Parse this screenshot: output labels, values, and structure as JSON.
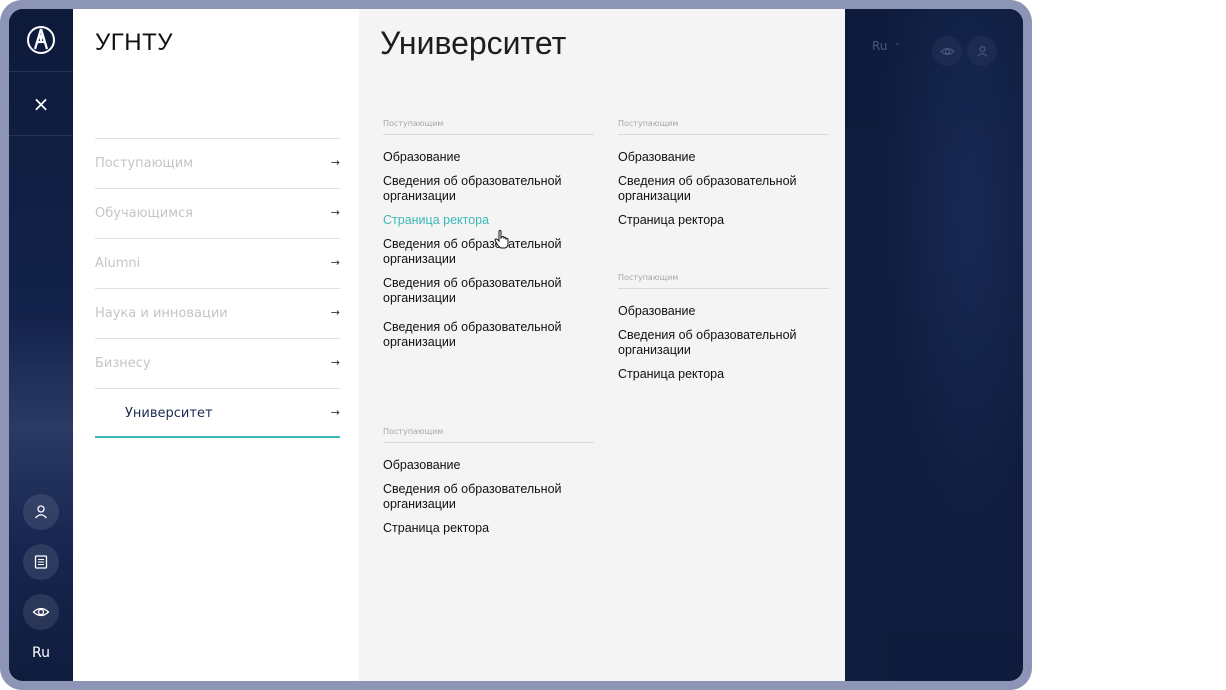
{
  "rail": {
    "logo_icon": "university-logo-icon",
    "close_icon": "close-icon",
    "close_glyph": "×",
    "buttons": [
      {
        "icon": "user-icon"
      },
      {
        "icon": "document-icon"
      },
      {
        "icon": "eye-icon"
      }
    ],
    "lang": "Ru"
  },
  "menu": {
    "title": "УГНТУ",
    "items": [
      {
        "label": "Поступающим",
        "arrow": "→"
      },
      {
        "label": "Обучающимся",
        "arrow": "→"
      },
      {
        "label": "Alumni",
        "arrow": "→"
      },
      {
        "label": "Наука и инновации",
        "arrow": "→"
      },
      {
        "label": "Бизнесу",
        "arrow": "→"
      },
      {
        "label": "Университет",
        "arrow": "→",
        "active": true
      }
    ]
  },
  "content": {
    "title": "Университет",
    "sections": [
      {
        "label": "Поступающим",
        "links": [
          "Образование",
          "Сведения об образовательной организации",
          "Страница ректора",
          "Сведения об образовательной организации",
          "Сведения об образовательной организации",
          "Сведения об образовательной организации"
        ]
      },
      {
        "label": "Поступающим",
        "links": [
          "Образование",
          "Сведения об образовательной организации",
          "Страница ректора"
        ]
      },
      {
        "label": "Поступающим",
        "links": [
          "Образование",
          "Сведения об образовательной организации",
          "Страница ректора"
        ]
      },
      {
        "label": "Поступающим",
        "links": [
          "Образование",
          "Сведения об образовательной организации",
          "Страница ректора"
        ]
      }
    ],
    "highlighted_link": "Страница ректора"
  },
  "top_right": {
    "lang": "Ru",
    "chevron": "˅",
    "icons": [
      "eye-icon",
      "user-icon"
    ]
  },
  "colors": {
    "accent": "#3ab9b8",
    "dark_bg": "#0f1c3d",
    "frame": "#8d95b6"
  }
}
